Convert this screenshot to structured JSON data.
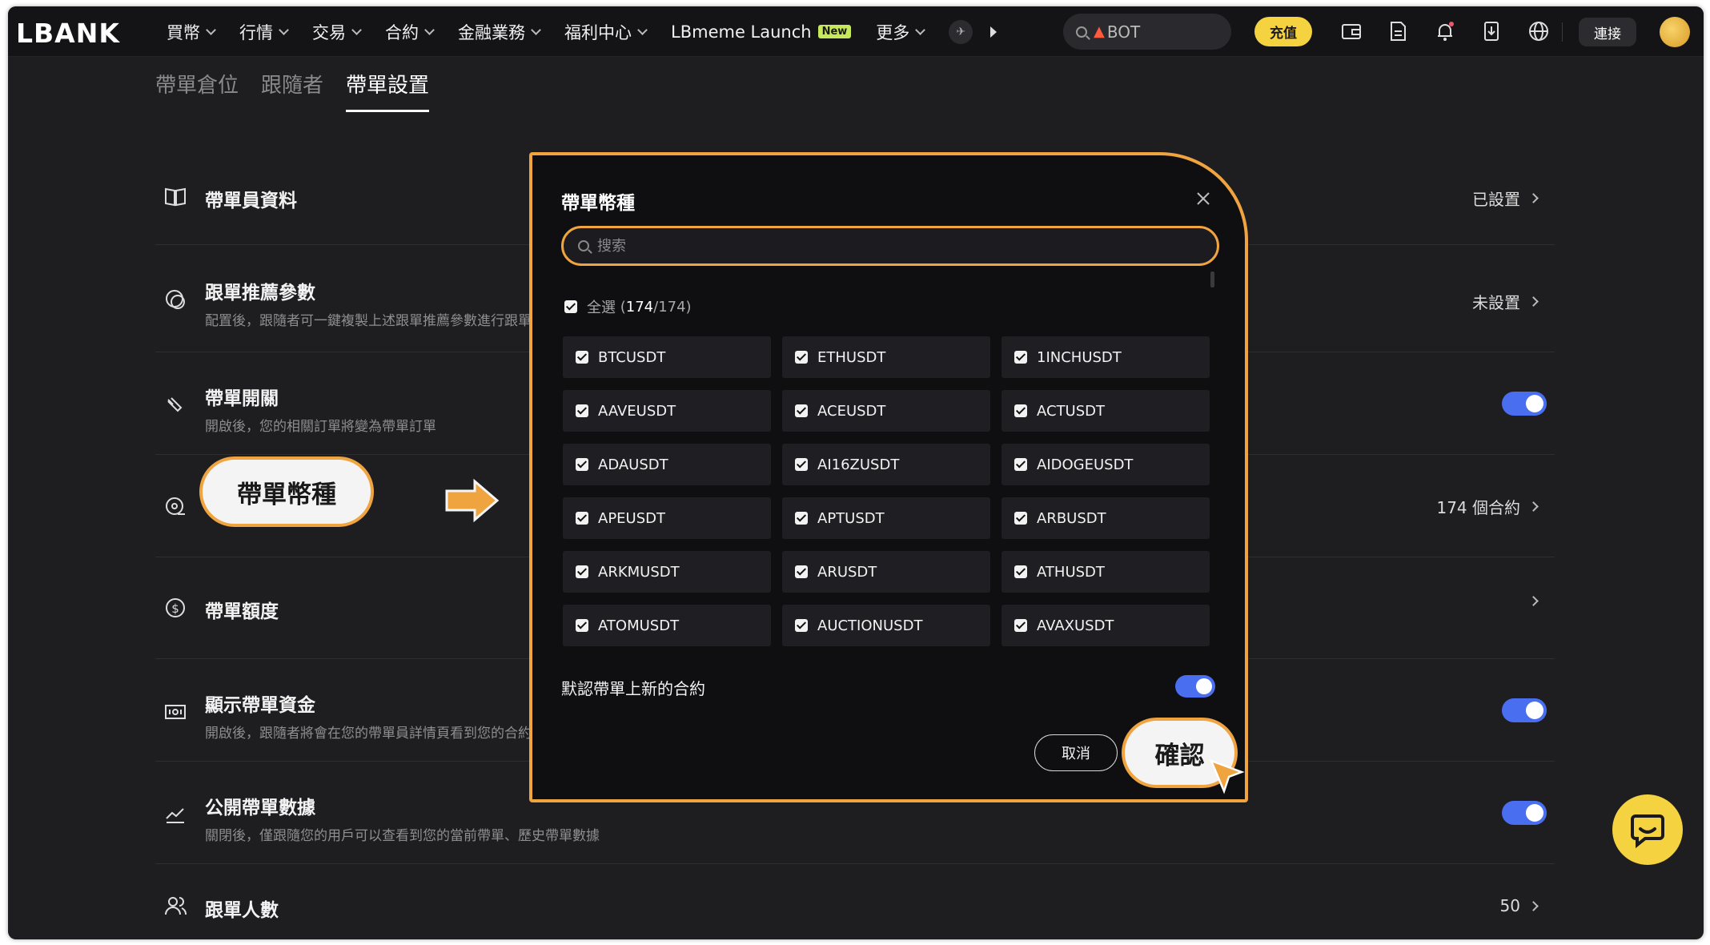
{
  "brand": {
    "logo": "LBANK"
  },
  "nav": {
    "items": [
      {
        "label": "買幣",
        "chevron": true
      },
      {
        "label": "行情",
        "chevron": true
      },
      {
        "label": "交易",
        "chevron": true
      },
      {
        "label": "合約",
        "chevron": true
      },
      {
        "label": "金融業務",
        "chevron": true
      },
      {
        "label": "福利中心",
        "chevron": true
      },
      {
        "label": "LBmeme Launch",
        "badge": "New",
        "chevron": false
      },
      {
        "label": "更多",
        "chevron": true
      }
    ],
    "search_placeholder": "BOT",
    "deposit_label": "充值",
    "connect_label": "連接"
  },
  "tabs": [
    {
      "label": "帶單倉位",
      "active": false
    },
    {
      "label": "跟隨者",
      "active": false
    },
    {
      "label": "帶單設置",
      "active": true
    }
  ],
  "settings": {
    "profile": {
      "title": "帶單員資料",
      "value": "已設置"
    },
    "recommend": {
      "title": "跟單推薦參數",
      "desc": "配置後，跟隨者可一鍵複製上述跟單推薦參數進行跟單",
      "value": "未設置"
    },
    "switch": {
      "title": "帶單開關",
      "desc": "開啟後，您的相關訂單將變為帶單訂單",
      "on": true
    },
    "coins": {
      "value": "174 個合約"
    },
    "quota": {
      "title": "帶單額度"
    },
    "show_funds": {
      "title": "顯示帶單資金",
      "desc": "開啟後，跟隨者將會在您的帶單員詳情頁看到您的合約帶單資金",
      "on": true
    },
    "public_data": {
      "title": "公開帶單數據",
      "desc": "關閉後，僅跟隨您的用戶可以查看到您的當前帶單、歷史帶單數據",
      "on": true
    },
    "follower_count": {
      "title": "跟單人數",
      "value": "50"
    }
  },
  "callout": {
    "label": "帶單幣種"
  },
  "modal": {
    "title": "帶單幣種",
    "search_placeholder": "搜索",
    "select_all_label": "全選",
    "selected_count": "174",
    "total_count": "174",
    "coins": [
      "BTCUSDT",
      "ETHUSDT",
      "1INCHUSDT",
      "AAVEUSDT",
      "ACEUSDT",
      "ACTUSDT",
      "ADAUSDT",
      "AI16ZUSDT",
      "AIDOGEUSDT",
      "APEUSDT",
      "APTUSDT",
      "ARBUSDT",
      "ARKMUSDT",
      "ARUSDT",
      "ATHUSDT",
      "ATOMUSDT",
      "AUCTIONUSDT",
      "AVAXUSDT"
    ],
    "default_new_label": "默認帶單上新的合約",
    "default_new_on": true,
    "cancel_label": "取消",
    "confirm_label": "確認"
  },
  "colors": {
    "accent_orange": "#f0a440",
    "toggle_blue": "#4a6ef0",
    "brand_yellow": "#f5d23f"
  }
}
